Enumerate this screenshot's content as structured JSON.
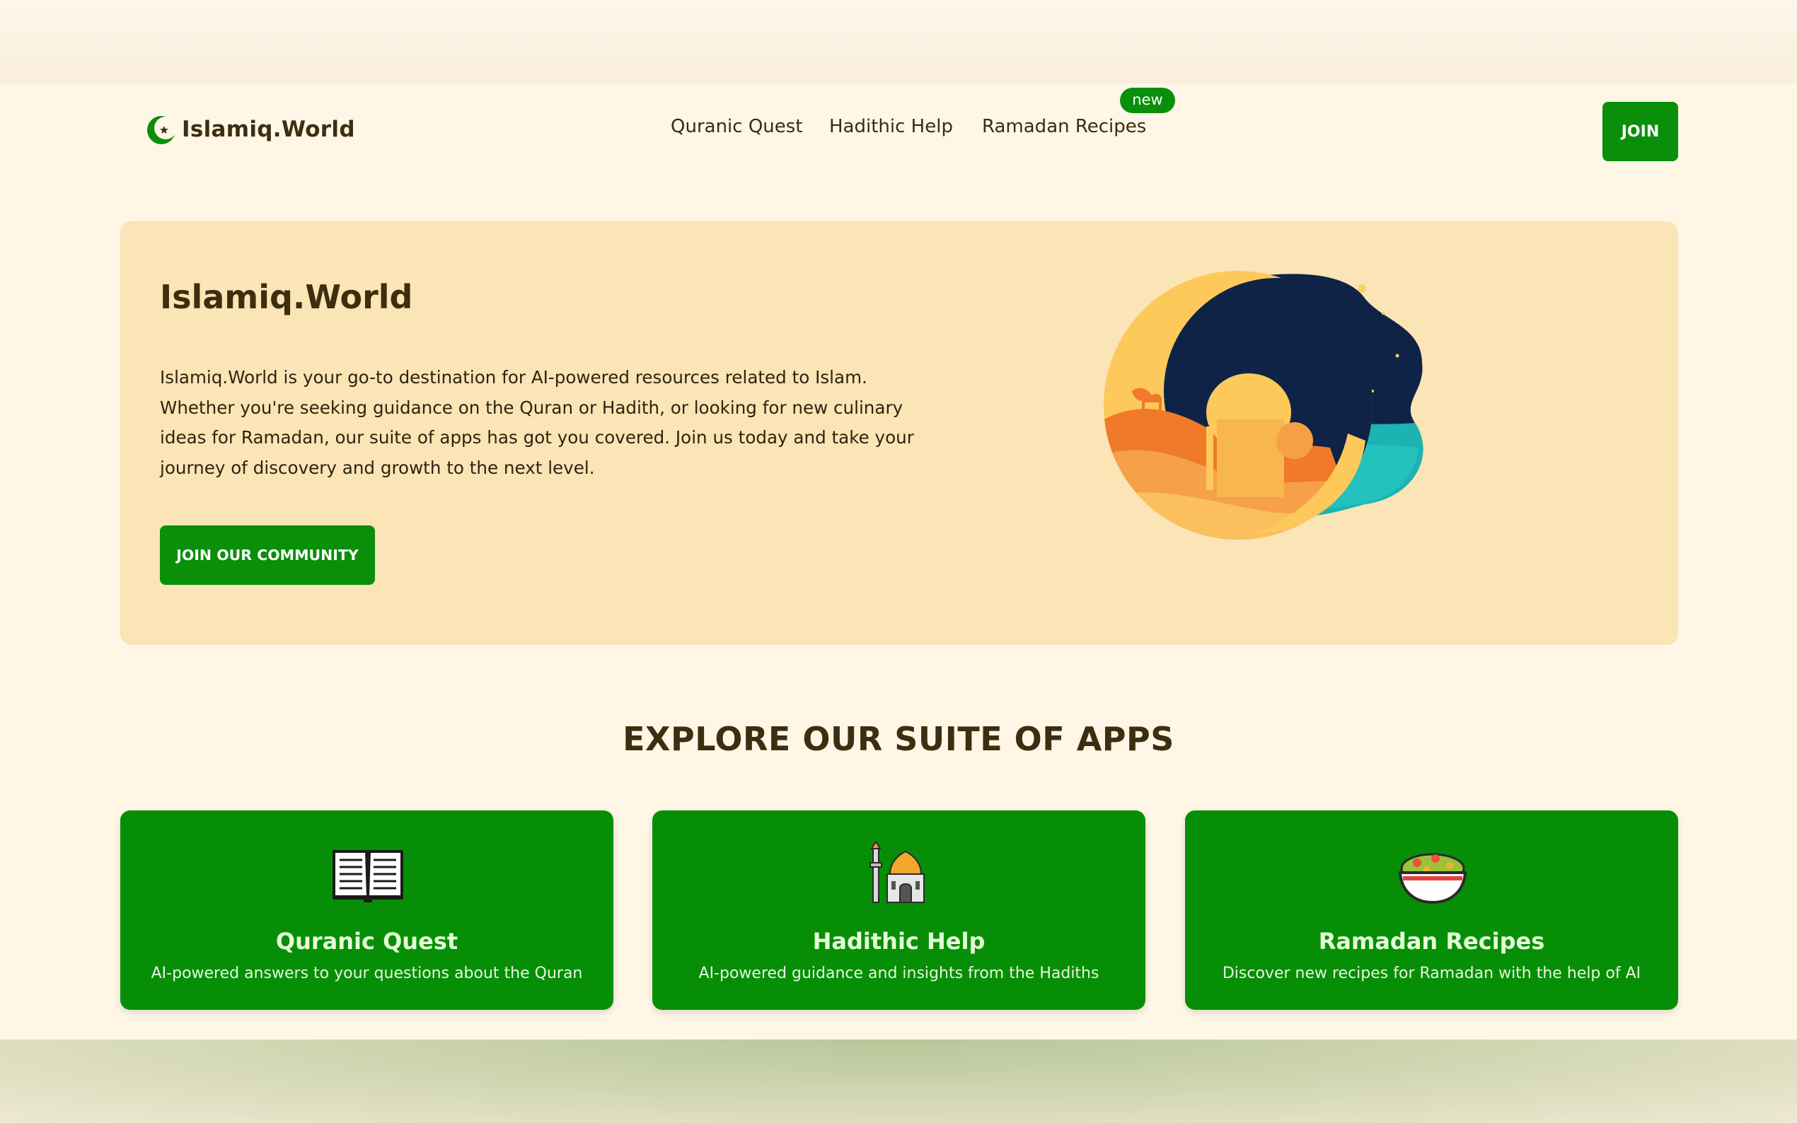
{
  "header": {
    "brand": "Islamiq.World",
    "nav": [
      {
        "label": "Quranic Quest"
      },
      {
        "label": "Hadithic Help"
      },
      {
        "label": "Ramadan Recipes",
        "badge": "new"
      }
    ],
    "join_label": "JOIN"
  },
  "hero": {
    "title": "Islamiq.World",
    "paragraph": "Islamiq.World is your go-to destination for AI-powered resources related to Islam. Whether you're seeking guidance on the Quran or Hadith, or looking for new culinary ideas for Ramadan, our suite of apps has got you covered. Join us today and take your journey of discovery and growth to the next level.",
    "cta_label": "JOIN OUR COMMUNITY",
    "illustration": "crescent-moon-mosque-icon"
  },
  "suite": {
    "title": "EXPLORE OUR SUITE OF APPS",
    "cards": [
      {
        "title": "Quranic Quest",
        "description": "AI-powered answers to your questions about the Quran",
        "icon": "open-book-icon"
      },
      {
        "title": "Hadithic Help",
        "description": "AI-powered guidance and insights from the Hadiths",
        "icon": "mosque-icon"
      },
      {
        "title": "Ramadan Recipes",
        "description": "Discover new recipes for Ramadan with the help of AI",
        "icon": "food-bowl-icon"
      }
    ]
  },
  "colors": {
    "accent": "#0a8f0a",
    "page_bg": "#fff6e6",
    "hero_bg": "#fbe4b5",
    "text": "#3d2e10"
  }
}
